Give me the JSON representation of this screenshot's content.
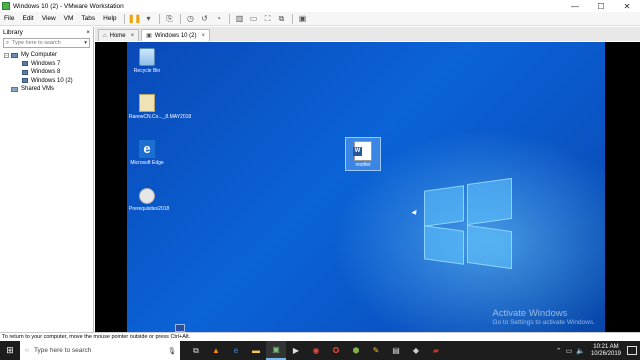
{
  "window": {
    "title": "Windows 10 (2) - VMware Workstation",
    "minimize": "—",
    "maximize": "☐",
    "close": "✕"
  },
  "menu": [
    "File",
    "Edit",
    "View",
    "VM",
    "Tabs",
    "Help"
  ],
  "library": {
    "title": "Library",
    "close": "×",
    "search_placeholder": "Type here to search",
    "tree": {
      "root": "My Computer",
      "vms": [
        "Windows 7",
        "Windows 8",
        "Windows 10 (2)"
      ],
      "shared": "Shared VMs"
    }
  },
  "tabs": [
    {
      "label": "Home",
      "close": "×"
    },
    {
      "label": "Windows 10 (2)",
      "close": "×"
    }
  ],
  "desktop": {
    "icons": [
      {
        "label": "Recycle Bin"
      },
      {
        "label": "RarewCN.Co..._8.MAY2018"
      },
      {
        "label": "Microsoft Edge"
      },
      {
        "label": "Prerequisites2018"
      }
    ],
    "selected_icon": {
      "label": "motifet"
    },
    "watermark_title": "Activate Windows",
    "watermark_sub": "Go to Settings to activate Windows."
  },
  "statusbar": {
    "text": "To return to your computer, move the mouse pointer outside or press Ctrl+Alt."
  },
  "taskbar": {
    "search_placeholder": "Type here to search",
    "time": "10:21 AM",
    "date": "10/26/2019"
  }
}
